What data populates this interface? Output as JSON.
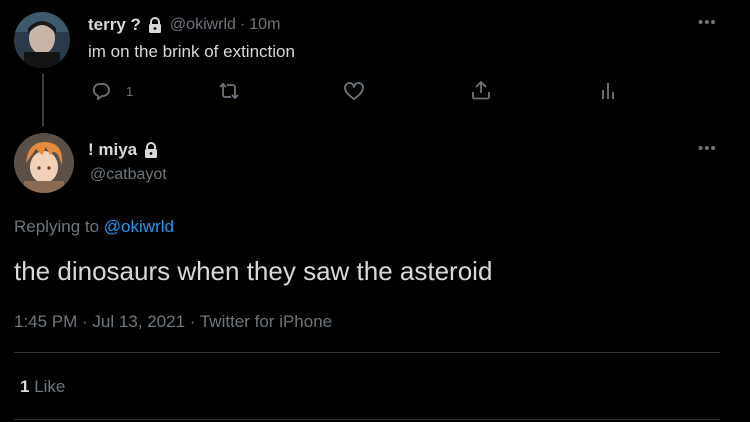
{
  "parent": {
    "name": "terry ?",
    "handle": "@okiwrld",
    "dot": "·",
    "time": "10m",
    "text": "im on the brink of extinction",
    "reply_count": "1",
    "more": "•••"
  },
  "main": {
    "name": "! miya",
    "handle": "@catbayot",
    "more": "•••",
    "replying_prefix": "Replying to",
    "replying_to": "@okiwrld",
    "text": "the dinosaurs when they saw the asteroid",
    "meta": "1:45 PM · Jul 13, 2021 · Twitter for iPhone",
    "likes_count": "1",
    "likes_label": "Like"
  },
  "colors": {
    "background": "#000000",
    "text": "#d9d9d9",
    "muted": "#6e767d",
    "link": "#1d9bf0",
    "divider": "#2f3336"
  },
  "icons": [
    "lock-icon",
    "reply-icon",
    "retweet-icon",
    "like-icon",
    "share-icon",
    "analytics-icon",
    "more-icon"
  ]
}
